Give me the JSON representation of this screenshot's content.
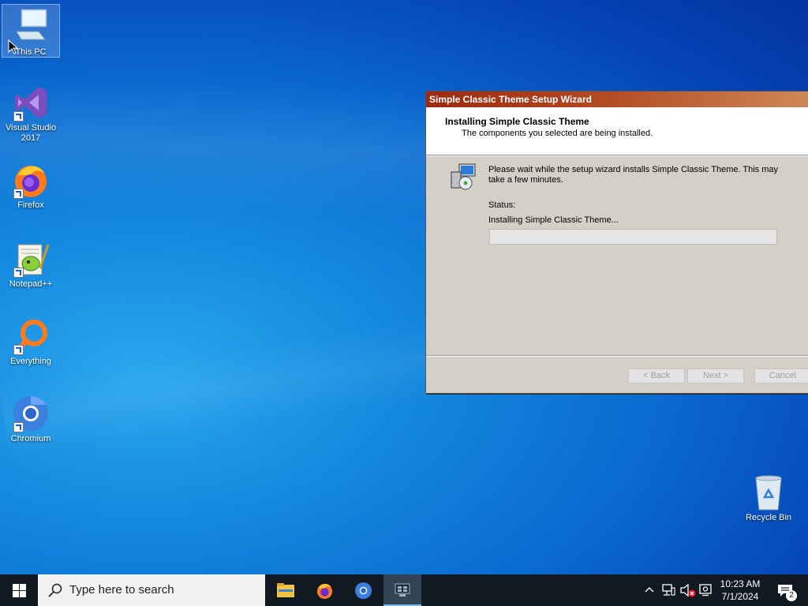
{
  "desktop": {
    "icons": [
      {
        "label": "This PC",
        "icon": "computer-icon"
      },
      {
        "label": "Visual Studio 2017",
        "icon": "visual-studio-icon"
      },
      {
        "label": "Firefox",
        "icon": "firefox-icon"
      },
      {
        "label": "Notepad++",
        "icon": "notepad-plus-plus-icon"
      },
      {
        "label": "Everything",
        "icon": "everything-search-icon"
      },
      {
        "label": "Chromium",
        "icon": "chromium-icon"
      },
      {
        "label": "Recycle Bin",
        "icon": "recycle-bin-icon"
      }
    ]
  },
  "wizard": {
    "title": "Simple Classic Theme Setup Wizard",
    "header_title": "Installing Simple Classic Theme",
    "header_subtitle": "The components you selected are being installed.",
    "message": "Please wait while the setup wizard installs Simple Classic Theme. This may take a few minutes.",
    "status_label": "Status:",
    "status_text": "Installing Simple Classic Theme...",
    "progress": 0,
    "buttons": {
      "back": "< Back",
      "next": "Next >",
      "cancel": "Cancel"
    },
    "title_color": "#9a2a10"
  },
  "taskbar": {
    "search_placeholder": "Type here to search",
    "apps": [
      "file-explorer-icon",
      "firefox-icon",
      "chromium-icon",
      "setup-wizard-icon"
    ],
    "clock_time": "10:23 AM",
    "clock_date": "7/1/2024",
    "notification_count": "2",
    "accent": "#76b9ed"
  }
}
